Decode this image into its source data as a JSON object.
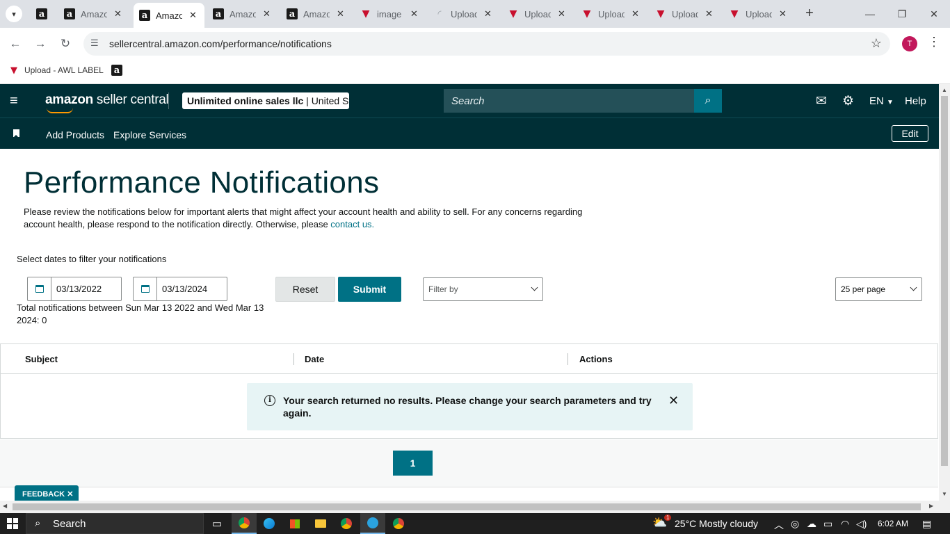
{
  "browser": {
    "tabs": [
      {
        "title": "",
        "favicon": "amazon",
        "active": false,
        "closable": false
      },
      {
        "title": "Amazon",
        "favicon": "amazon",
        "active": false,
        "closable": true
      },
      {
        "title": "Amazon",
        "favicon": "amazon",
        "active": true,
        "closable": true
      },
      {
        "title": "Amazon",
        "favicon": "amazon",
        "active": false,
        "closable": true
      },
      {
        "title": "Amazon",
        "favicon": "amazon",
        "active": false,
        "closable": true
      },
      {
        "title": "image",
        "favicon": "awl",
        "active": false,
        "closable": true
      },
      {
        "title": "Upload",
        "favicon": "loading",
        "active": false,
        "closable": true
      },
      {
        "title": "Upload",
        "favicon": "awl",
        "active": false,
        "closable": true
      },
      {
        "title": "Upload",
        "favicon": "awl",
        "active": false,
        "closable": true
      },
      {
        "title": "Upload",
        "favicon": "awl",
        "active": false,
        "closable": true
      },
      {
        "title": "Upload",
        "favicon": "awl",
        "active": false,
        "closable": true
      }
    ],
    "url": "sellercentral.amazon.com/performance/notifications",
    "profile_initial": "T",
    "bookmarks": [
      {
        "label": "Upload - AWL LABEL",
        "favicon": "awl"
      },
      {
        "label": "",
        "favicon": "amazon"
      }
    ]
  },
  "seller_central": {
    "logo_bold": "amazon",
    "logo_rest": " seller central",
    "account_name": "Unlimited online sales llc",
    "account_region": " | United States",
    "search_placeholder": "Search",
    "language": "EN",
    "help": "Help",
    "subnav": [
      "Add Products",
      "Explore Services"
    ],
    "edit_label": "Edit"
  },
  "page": {
    "title": "Performance Notifications",
    "description": "Please review the notifications below for important alerts that might affect your account health and ability to sell. For any concerns regarding account health, please respond to the notification directly. Otherwise, please ",
    "contact_link": "contact us.",
    "filter_label": "Select dates to filter your notifications",
    "start_date": "03/13/2022",
    "end_date": "03/13/2024",
    "reset_label": "Reset",
    "submit_label": "Submit",
    "filter_by_placeholder": "Filter by",
    "per_page": "25 per page",
    "total_text": "Total notifications between Sun Mar 13 2022 and Wed Mar 13 2024: 0",
    "table_headers": [
      "Subject",
      "Date",
      "Actions"
    ],
    "no_results": "Your search returned no results. Please change your search parameters and try again.",
    "current_page": "1",
    "feedback_label": "FEEDBACK"
  },
  "taskbar": {
    "search_label": "Search",
    "weather": "25°C  Mostly cloudy",
    "weather_badge": "1",
    "time": "6:02 AM"
  },
  "colors": {
    "header_bg": "#002f36",
    "accent_teal": "#007185",
    "alert_bg": "#e7f4f5"
  }
}
